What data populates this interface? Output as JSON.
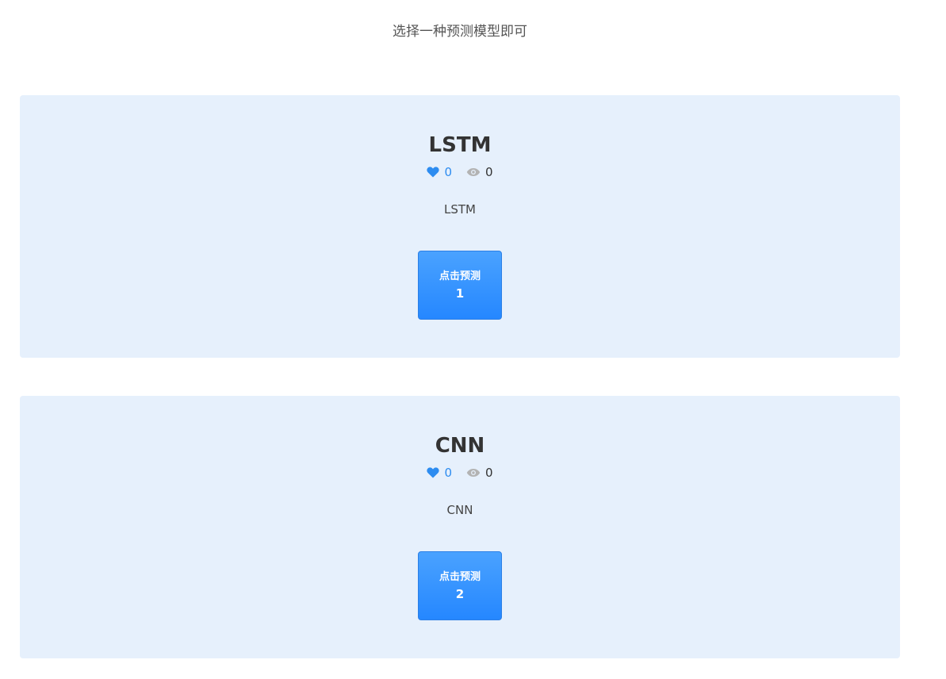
{
  "header": {
    "subtitle": "选择一种预测模型即可"
  },
  "colors": {
    "card_background": "#e6f0fc",
    "accent": "#2d8cf0",
    "button_gradient_top": "#4aa2ff",
    "button_gradient_bottom": "#2587ff",
    "view_icon": "#b3b3b3"
  },
  "models": [
    {
      "title": "LSTM",
      "likes": "0",
      "views": "0",
      "description": "LSTM",
      "button_label": "点击预测",
      "button_number": "1",
      "like_icon": "heart-icon",
      "view_icon": "eye-icon"
    },
    {
      "title": "CNN",
      "likes": "0",
      "views": "0",
      "description": "CNN",
      "button_label": "点击预测",
      "button_number": "2",
      "like_icon": "heart-icon",
      "view_icon": "eye-icon"
    }
  ]
}
